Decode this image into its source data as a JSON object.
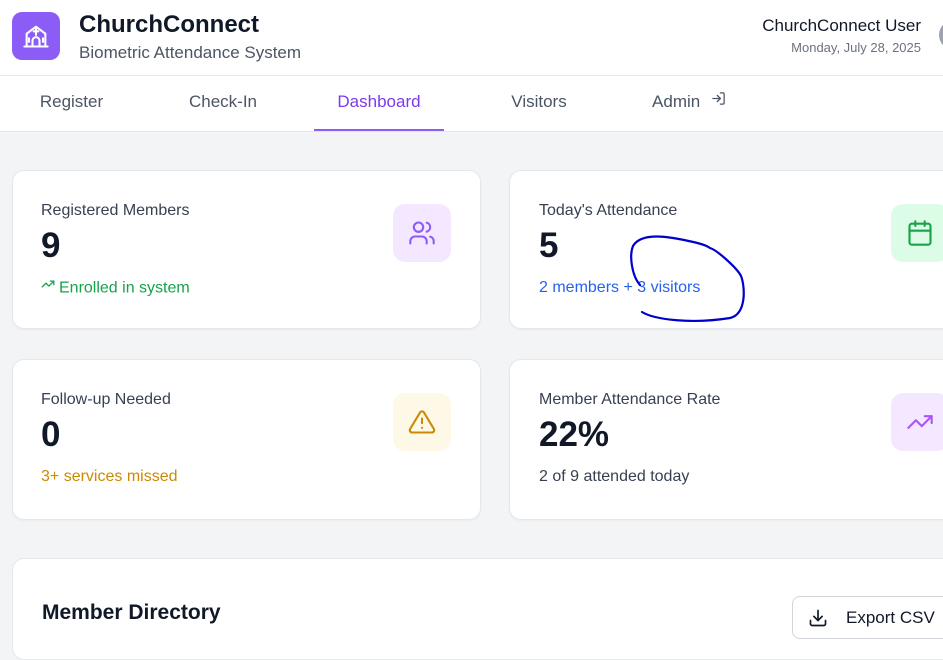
{
  "header": {
    "app_title": "ChurchConnect",
    "app_subtitle": "Biometric Attendance System",
    "user_name": "ChurchConnect User",
    "date": "Monday, July 28, 2025",
    "logo_icon": "church-icon"
  },
  "nav": {
    "tabs": [
      {
        "label": "Register"
      },
      {
        "label": "Check-In"
      },
      {
        "label": "Dashboard",
        "active": true
      },
      {
        "label": "Visitors"
      },
      {
        "label": "Admin",
        "icon": "sign-in-icon"
      }
    ]
  },
  "stats": {
    "registered": {
      "label": "Registered Members",
      "value": "9",
      "sub": "Enrolled in system",
      "icon": "users-icon",
      "accent": "#16a34a"
    },
    "attendance": {
      "label": "Today's Attendance",
      "value": "5",
      "sub": "2 members + 3 visitors",
      "icon": "calendar-icon",
      "accent": "#2563eb"
    },
    "followup": {
      "label": "Follow-up Needed",
      "value": "0",
      "sub": "3+ services missed",
      "icon": "alert-triangle-icon",
      "accent": "#ca8a04"
    },
    "rate": {
      "label": "Member Attendance Rate",
      "value": "22%",
      "sub": "2 of 9 attended today",
      "icon": "trending-up-icon",
      "accent": "#4b5563"
    }
  },
  "directory": {
    "title": "Member Directory",
    "export_label": "Export CSV",
    "export_icon": "download-icon"
  },
  "colors": {
    "brand": "#8b5cf6",
    "annotation": "#0000cc"
  }
}
